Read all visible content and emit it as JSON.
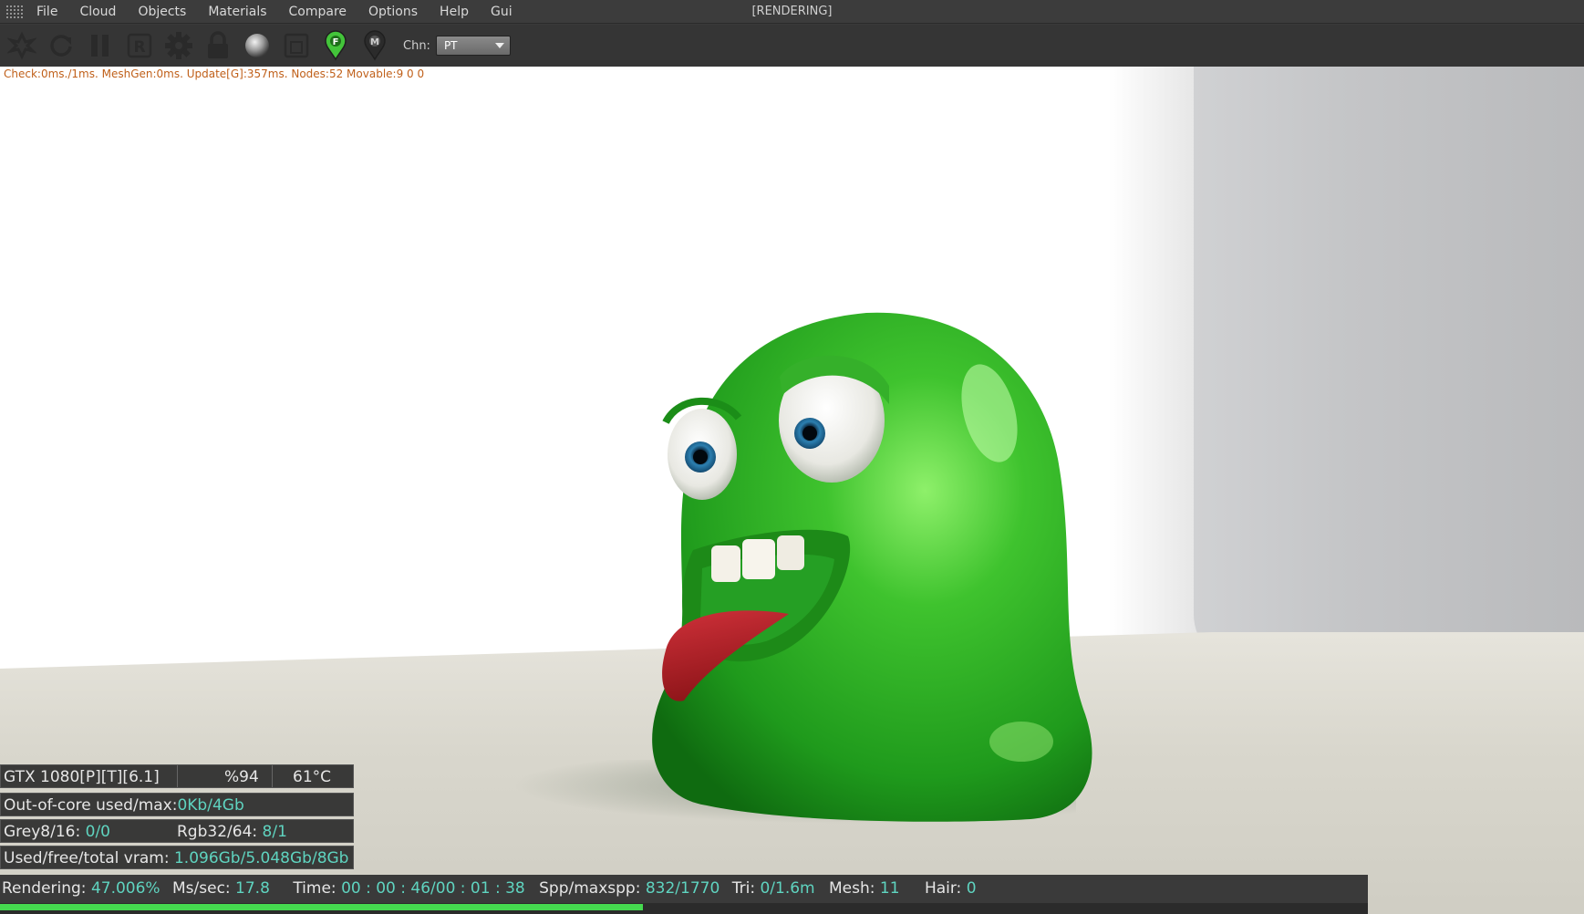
{
  "window": {
    "status": "[RENDERING]"
  },
  "menu": [
    "File",
    "Cloud",
    "Objects",
    "Materials",
    "Compare",
    "Options",
    "Help",
    "Gui"
  ],
  "toolbar": {
    "buttons": [
      "clear-render-icon",
      "restart-icon",
      "pause-icon",
      "region-render-icon",
      "settings-gear-icon",
      "lock-icon",
      "material-sphere-icon",
      "focus-picker-icon",
      "focus-pin-icon",
      "material-pin-icon"
    ],
    "focus_pin_letter": "F",
    "material_pin_letter": "M",
    "region_letter": "R",
    "channel_label": "Chn:",
    "channel_value": "PT"
  },
  "viewport": {
    "stats": "Check:0ms./1ms. MeshGen:0ms. Update[G]:357ms. Nodes:52 Movable:9  0 0"
  },
  "gpu": {
    "name": "GTX 1080[P][T][6.1]",
    "usage": "%94",
    "temp": "61°C",
    "out_of_core_label": "Out-of-core used/max:",
    "out_of_core_value": "0Kb/4Gb",
    "grey_label": "Grey8/16: ",
    "grey_value": "0/0",
    "rgb_label": "Rgb32/64: ",
    "rgb_value": "8/1",
    "vram_label": "Used/free/total vram: ",
    "vram_value": "1.096Gb/5.048Gb/8Gb"
  },
  "status": {
    "rendering_label": "Rendering: ",
    "rendering_value": "47.006%",
    "progress": 0.47006,
    "mssec_label": "Ms/sec: ",
    "mssec_value": "17.8",
    "time_label": "Time: ",
    "time_value": "00 : 00 : 46/00 : 01 : 38",
    "spp_label": "Spp/maxspp: ",
    "spp_value": "832/1770",
    "tri_label": "Tri: ",
    "tri_value": "0/1.6m",
    "mesh_label": "Mesh: ",
    "mesh_value": "11",
    "hair_label": "Hair: ",
    "hair_value": "0"
  },
  "colors": {
    "accent_value": "#5fd4c0",
    "progress": "#45d94f",
    "stats_text": "#c0601a"
  }
}
